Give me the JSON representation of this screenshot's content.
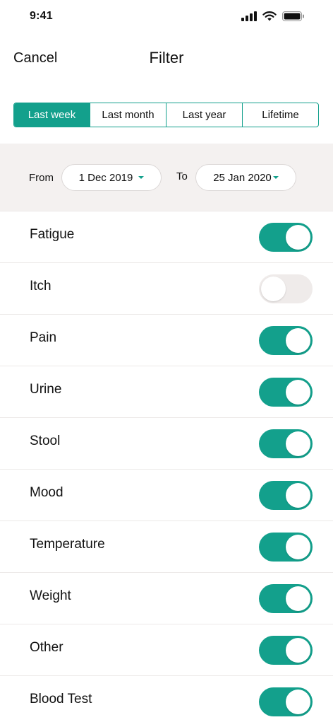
{
  "status_bar": {
    "time": "9:41",
    "icons": [
      "cellular-signal-icon",
      "wifi-icon",
      "battery-icon"
    ]
  },
  "nav": {
    "cancel_label": "Cancel",
    "title": "Filter"
  },
  "range_tabs": [
    {
      "label": "Last week",
      "active": true
    },
    {
      "label": "Last month",
      "active": false
    },
    {
      "label": "Last year",
      "active": false
    },
    {
      "label": "Lifetime",
      "active": false
    }
  ],
  "date_range": {
    "from_label": "From",
    "from_value": "1 Dec 2019",
    "to_label": "To",
    "to_value": "25 Jan 2020"
  },
  "filters": [
    {
      "label": "Fatigue",
      "enabled": true
    },
    {
      "label": "Itch",
      "enabled": false
    },
    {
      "label": "Pain",
      "enabled": true
    },
    {
      "label": "Urine",
      "enabled": true
    },
    {
      "label": "Stool",
      "enabled": true
    },
    {
      "label": "Mood",
      "enabled": true
    },
    {
      "label": "Temperature",
      "enabled": true
    },
    {
      "label": "Weight",
      "enabled": true
    },
    {
      "label": "Other",
      "enabled": true
    },
    {
      "label": "Blood Test",
      "enabled": true
    }
  ],
  "colors": {
    "accent": "#13a08c",
    "date_band_bg": "#f4f1f0",
    "toggle_off": "#efebea"
  }
}
